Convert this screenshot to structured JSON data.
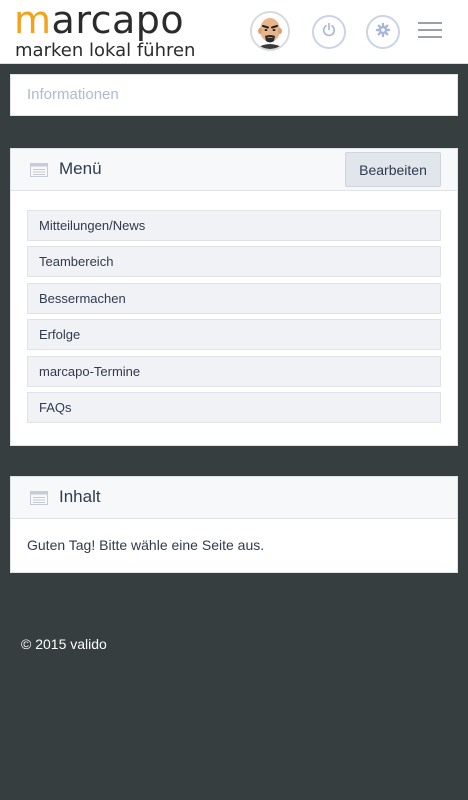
{
  "header": {
    "logo_word_accent": "m",
    "logo_word_rest": "arcapo",
    "logo_tagline": "marken lokal führen",
    "avatar_icon": "user-avatar-icon",
    "power_icon": "power-icon",
    "settings_icon": "gear-icon",
    "menu_icon": "hamburger-icon",
    "accent_color": "#f4a21c"
  },
  "info_panel": {
    "placeholder": "Informationen"
  },
  "menu_panel": {
    "icon": "list-icon",
    "title": "Menü",
    "edit_label": "Bearbeiten",
    "items": [
      {
        "label": "Mitteilungen/News"
      },
      {
        "label": "Teambereich"
      },
      {
        "label": "Bessermachen"
      },
      {
        "label": "Erfolge"
      },
      {
        "label": "marcapo-Termine"
      },
      {
        "label": "FAQs"
      }
    ]
  },
  "content_panel": {
    "icon": "list-icon",
    "title": "Inhalt",
    "text": "Guten Tag! Bitte wähle eine Seite aus."
  },
  "footer": {
    "copyright": "© 2015 valido"
  }
}
